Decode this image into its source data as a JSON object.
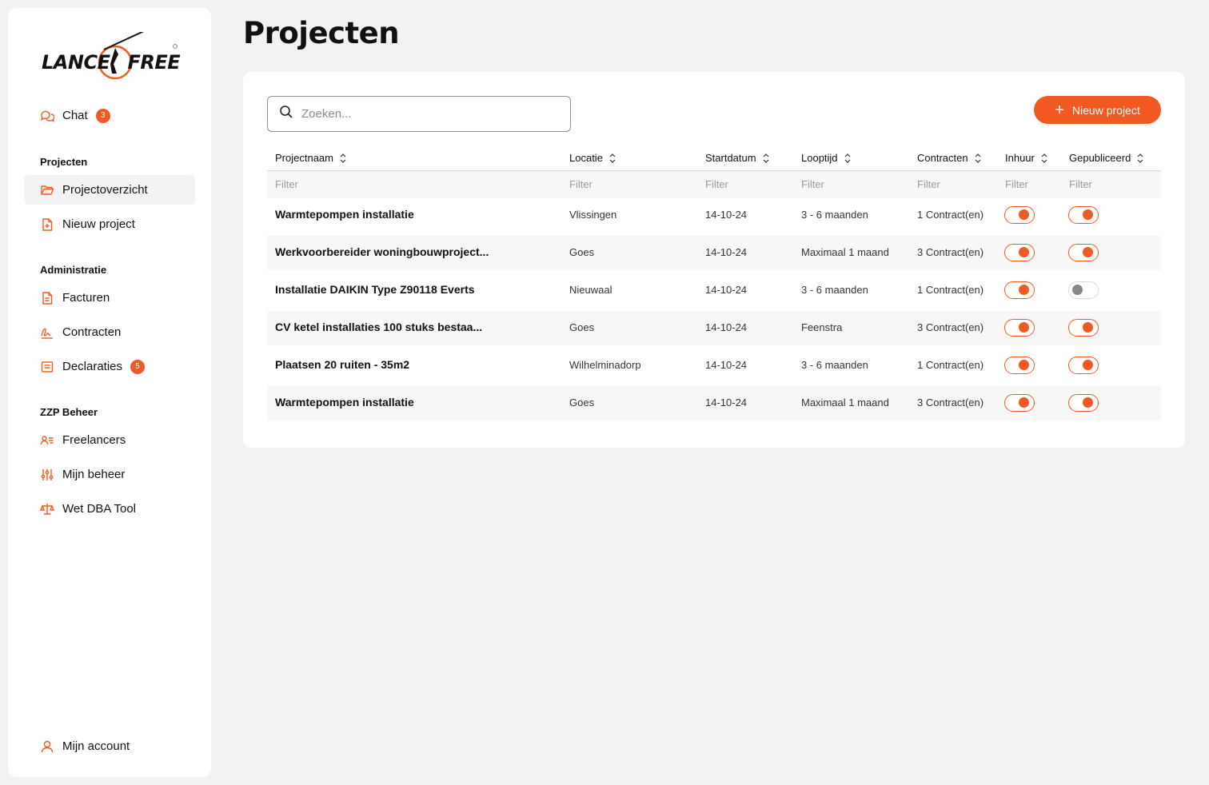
{
  "brand": {
    "logo_text_left": "LANCE",
    "logo_text_right": "FREE",
    "accent": "#f05a22"
  },
  "page": {
    "title": "Projecten"
  },
  "sidebar": {
    "chat": {
      "label": "Chat",
      "badge": "3",
      "icon": "chat-icon"
    },
    "sections": [
      {
        "title": "Projecten",
        "items": [
          {
            "label": "Projectoverzicht",
            "icon": "folder-open-icon",
            "active": true
          },
          {
            "label": "Nieuw project",
            "icon": "file-plus-icon"
          }
        ]
      },
      {
        "title": "Administratie",
        "items": [
          {
            "label": "Facturen",
            "icon": "document-icon"
          },
          {
            "label": "Contracten",
            "icon": "signature-icon"
          },
          {
            "label": "Declaraties",
            "icon": "receipt-icon",
            "badge": "5"
          }
        ]
      },
      {
        "title": "ZZP Beheer",
        "items": [
          {
            "label": "Freelancers",
            "icon": "users-list-icon"
          },
          {
            "label": "Mijn beheer",
            "icon": "sliders-icon"
          },
          {
            "label": "Wet DBA Tool",
            "icon": "scales-icon"
          }
        ]
      }
    ],
    "account": {
      "label": "Mijn account",
      "icon": "user-icon"
    }
  },
  "toolbar": {
    "search_placeholder": "Zoeken...",
    "new_button_label": "Nieuw project"
  },
  "table": {
    "columns": [
      "Projectnaam",
      "Locatie",
      "Startdatum",
      "Looptijd",
      "Contracten",
      "Inhuur",
      "Gepubliceerd"
    ],
    "filter_placeholder": "Filter",
    "rows": [
      {
        "name": "Warmtepompen installatie",
        "location": "Vlissingen",
        "start": "14-10-24",
        "duration": "3 - 6 maanden",
        "contracts": "1 Contract(en)",
        "inhuur": true,
        "published": true
      },
      {
        "name": "Werkvoorbereider woningbouwproject...",
        "location": "Goes",
        "start": "14-10-24",
        "duration": "Maximaal 1 maand",
        "contracts": "3 Contract(en)",
        "inhuur": true,
        "published": true
      },
      {
        "name": "Installatie DAIKIN Type Z90118 Everts",
        "location": "Nieuwaal",
        "start": "14-10-24",
        "duration": "3 - 6 maanden",
        "contracts": "1 Contract(en)",
        "inhuur": true,
        "published": false
      },
      {
        "name": "CV ketel installaties 100 stuks bestaa...",
        "location": "Goes",
        "start": "14-10-24",
        "duration": "Feenstra",
        "contracts": "3 Contract(en)",
        "inhuur": true,
        "published": true
      },
      {
        "name": "Plaatsen 20 ruiten - 35m2",
        "location": "Wilhelminadorp",
        "start": "14-10-24",
        "duration": "3 - 6 maanden",
        "contracts": "1 Contract(en)",
        "inhuur": true,
        "published": true
      },
      {
        "name": "Warmtepompen installatie",
        "location": "Goes",
        "start": "14-10-24",
        "duration": "Maximaal 1 maand",
        "contracts": "3 Contract(en)",
        "inhuur": true,
        "published": true
      }
    ]
  }
}
